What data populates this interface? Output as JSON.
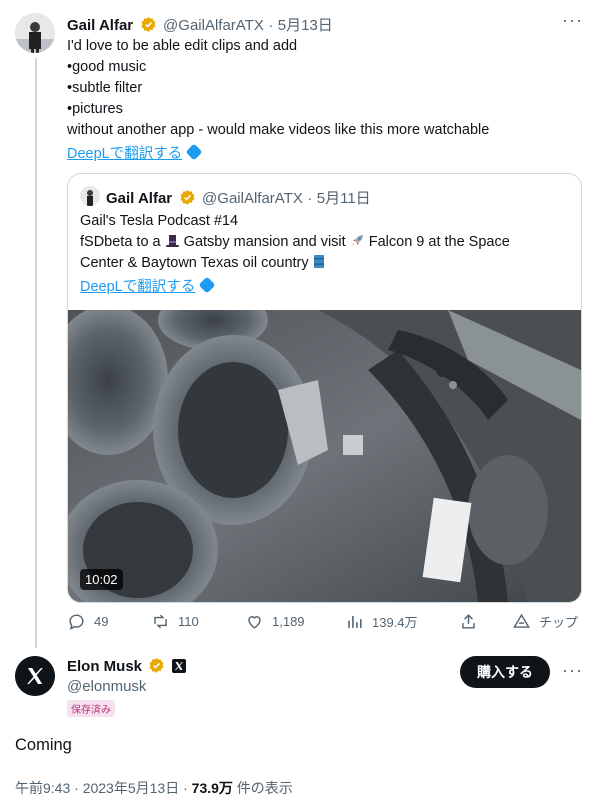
{
  "reply_tweet": {
    "name": "Gail Alfar",
    "handle": "@GailAlfarATX",
    "separator": "·",
    "date": "5月13日",
    "more": "···",
    "lines": [
      "I'd love to be able edit clips and add",
      "•good music",
      "•subtle filter",
      "•pictures",
      "without another app - would make videos like this more watchable"
    ],
    "translate_link": "DeepLで翻訳する"
  },
  "quoted_tweet": {
    "name": "Gail Alfar",
    "handle": "@GailAlfarATX",
    "separator": "·",
    "date": "5月11日",
    "line1": "Gail's Tesla Podcast #14",
    "line2_a": "fSDbeta to a ",
    "line2_b": " Gatsby mansion and visit ",
    "line2_c": " Falcon 9 at the Space",
    "line3": "Center & Baytown Texas oil country ",
    "translate_link": "DeepLで翻訳する",
    "video_duration": "10:02"
  },
  "actions": {
    "replies": "49",
    "retweets": "110",
    "likes": "1,189",
    "views": "139.4万",
    "tip": "チップ"
  },
  "main_tweet": {
    "name": "Elon Musk",
    "handle": "@elonmusk",
    "saved_badge": "保存済み",
    "buy_button": "購入する",
    "more": "···",
    "text": "Coming",
    "time": "午前9:43",
    "dot": "·",
    "date": "2023年5月13日",
    "views_count": "73.9万",
    "views_label": " 件の表示"
  },
  "colors": {
    "accent": "#1d9bf0",
    "gold_badge": "#e8a800",
    "text_secondary": "#536471"
  }
}
